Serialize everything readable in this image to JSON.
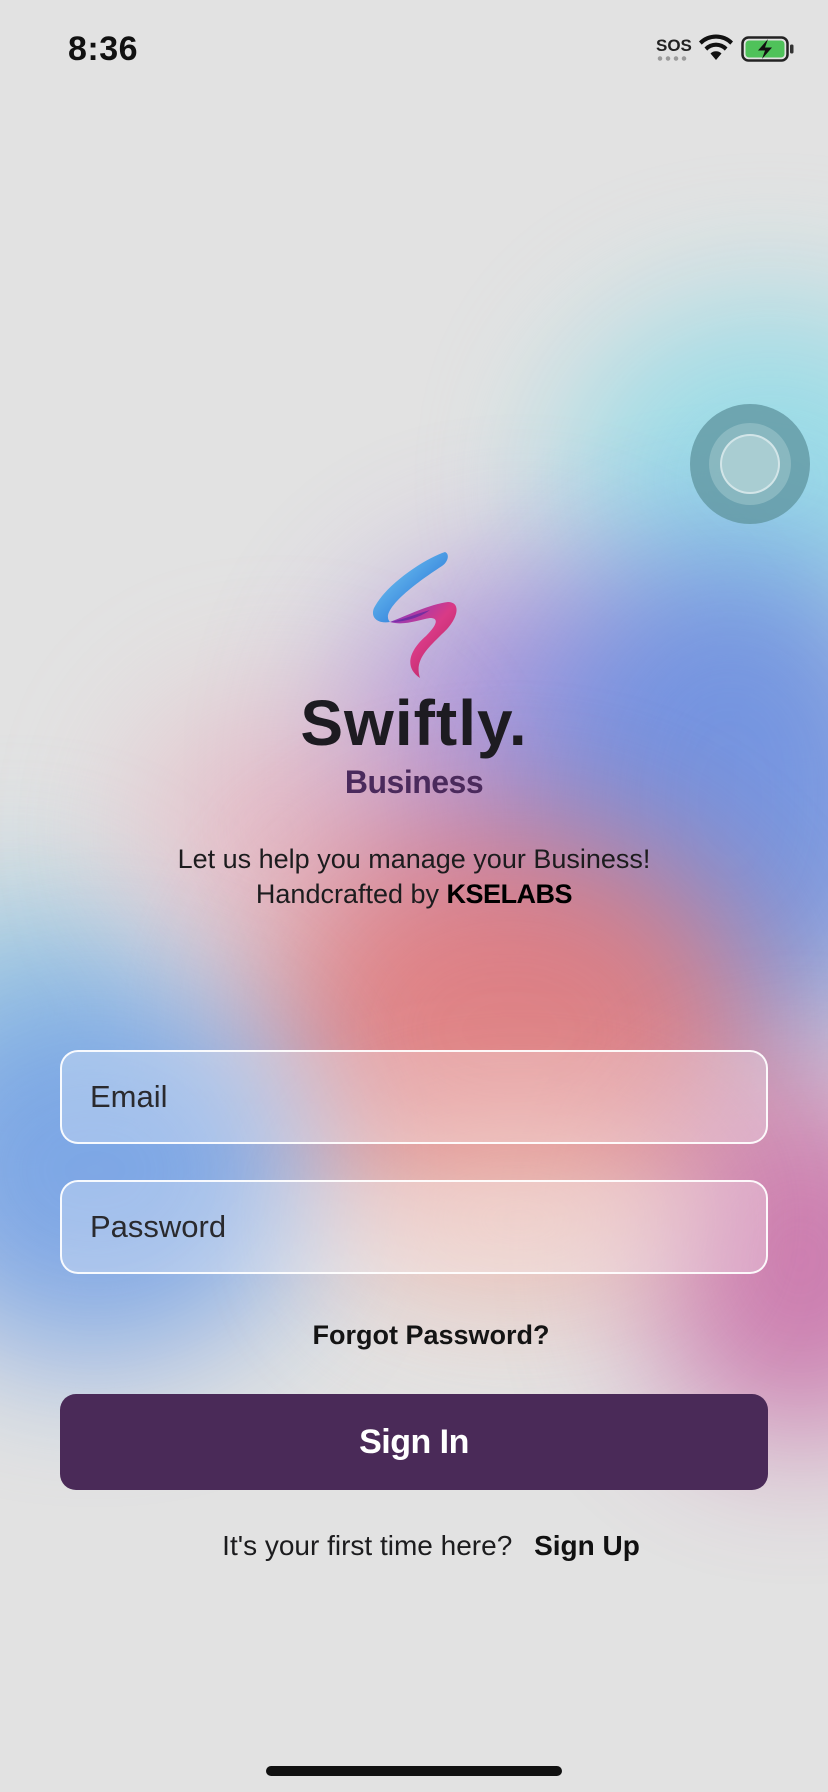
{
  "status_bar": {
    "time": "8:36",
    "sos": "SOS",
    "icons": [
      "wifi-icon",
      "battery-charging-icon"
    ]
  },
  "brand": {
    "name": "Swiftly.",
    "subtitle": "Business",
    "logo_icon": "swiftly-ribbon-logo",
    "subtitle_color": "#4a2a5c"
  },
  "tagline": {
    "line1": "Let us help you manage your Business!",
    "line2_prefix": "Handcrafted by",
    "line2_brand": "KSELABS"
  },
  "form": {
    "email_placeholder": "Email",
    "password_placeholder": "Password",
    "email_value": "",
    "password_value": ""
  },
  "actions": {
    "forgot_password": "Forgot Password?",
    "sign_in": "Sign In",
    "sign_up_prompt": "It's your first time here?",
    "sign_up": "Sign Up"
  },
  "colors": {
    "primary": "#4a2a58",
    "background": "#e3e3e3"
  }
}
